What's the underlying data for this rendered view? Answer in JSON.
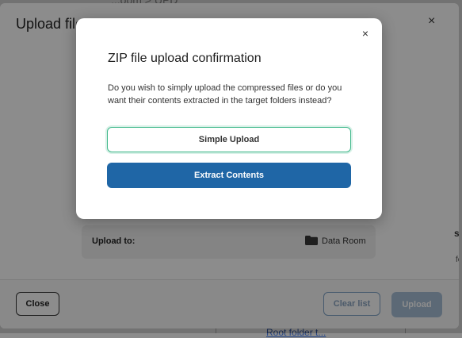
{
  "background": {
    "top_fragment": "...oom > UPD",
    "bottom_fragment": "Root folder t..."
  },
  "upload_modal": {
    "title": "Upload file",
    "close_glyph": "×",
    "upload_to_label": "Upload to:",
    "destination_folder": "Data Room",
    "side_fragment": "s",
    "side_fragment2": "fc",
    "buttons": {
      "close": "Close",
      "clear_list": "Clear list",
      "upload": "Upload"
    }
  },
  "confirm_dialog": {
    "title": "ZIP file upload confirmation",
    "message": "Do you wish to simply upload the compressed files or do you want their contents extracted in the target folders instead?",
    "close_glyph": "×",
    "simple_upload_label": "Simple Upload",
    "extract_contents_label": "Extract Contents"
  },
  "colors": {
    "primary": "#1f66a6",
    "focus_ring": "#3fb88a",
    "overlay": "rgba(0,0,0,0.45)"
  }
}
